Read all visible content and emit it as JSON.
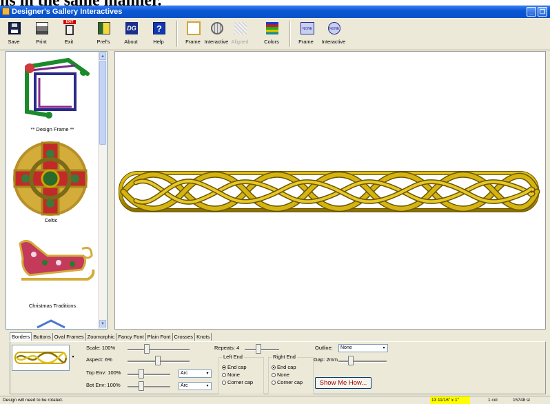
{
  "doc_heading": "ns in the same manner.",
  "window": {
    "title": "Designer's Gallery Interactives"
  },
  "window_buttons": {
    "minimize": "_",
    "restore": "❐"
  },
  "toolbar": {
    "save": "Save",
    "print": "Print",
    "exit": "Exit",
    "exit_badge": "EXIT",
    "prefs": "Pref's",
    "about": "About",
    "about_icon_text": "DG",
    "help": "Help",
    "help_icon_text": "?",
    "frame": "Frame",
    "interactive": "Interactive",
    "aligned": "Aligned",
    "colors": "Colors",
    "frame2": "Frame",
    "frame2_icon_text": "NONE",
    "interactive2": "Interactive",
    "interactive2_icon_text": "NONE"
  },
  "gallery": {
    "items": [
      {
        "label": "** Design Frame **"
      },
      {
        "label": "Celtic"
      },
      {
        "label": "Christmas Traditions"
      }
    ],
    "scroll_up": "▲",
    "scroll_down": "▼"
  },
  "tabs": [
    "Borders",
    "Buttons",
    "Oval Frames",
    "Zoomorphic",
    "Fancy Font",
    "Plain Font",
    "Crosses",
    "Knots"
  ],
  "controls": {
    "preview_dropdown": "▾",
    "scale": "Scale: 100%",
    "aspect": "Aspect: 6%",
    "top_env": "Top Env: 100%",
    "bot_env": "Bot Env: 100%",
    "top_env_shape": "Arc",
    "bot_env_shape": "Arc",
    "select_arrow": "▾",
    "repeats": "Repeats: 4",
    "left_end": {
      "title": "Left End",
      "options": [
        "End cap",
        "None",
        "Corner cap"
      ],
      "selected_index": 0
    },
    "right_end": {
      "title": "Right End",
      "options": [
        "End cap",
        "None",
        "Corner cap"
      ],
      "selected_index": 0
    },
    "outline_label": "Outline:",
    "outline_value": "None",
    "gap": "Gap: 2mm",
    "show_me": "Show Me How..."
  },
  "status": {
    "message": "Design will need to be rotated.",
    "dimensions": "13 11/16\" x 1\"",
    "colors": "1 col",
    "stitches": "15748 st"
  },
  "colors": {
    "title_bar": "#0a58d6",
    "knot_gold": "#c9a800",
    "knot_dark": "#6b5500",
    "highlight": "#ffff00"
  }
}
